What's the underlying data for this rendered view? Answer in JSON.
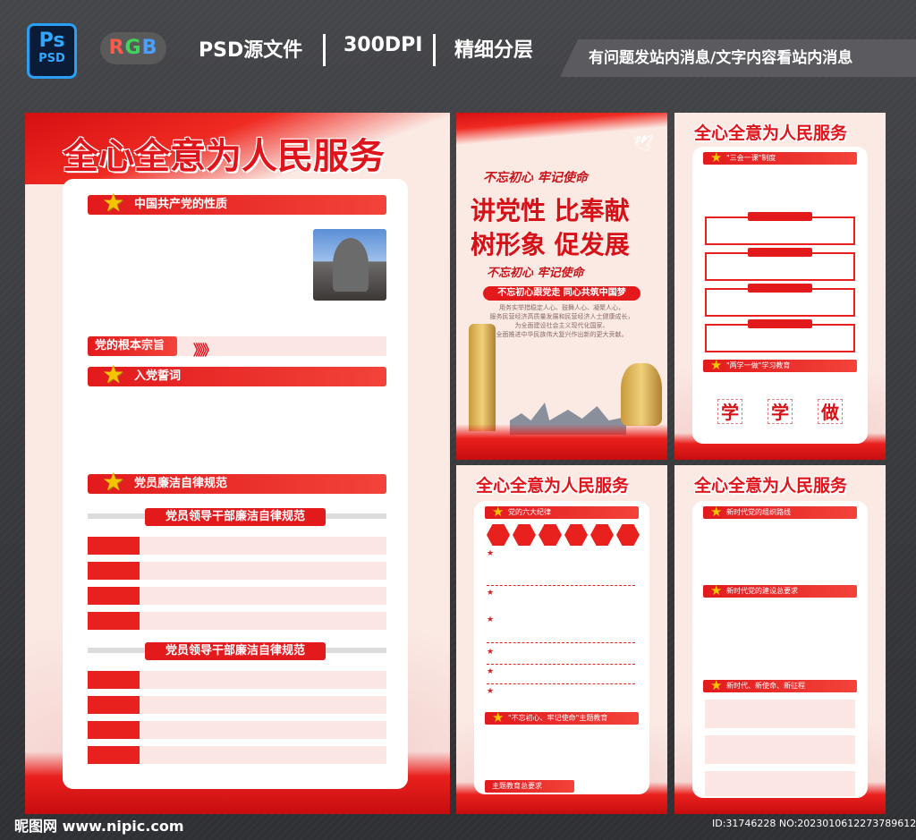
{
  "header": {
    "ps_big": "Ps",
    "ps_small": "PSD",
    "rgb": [
      "R",
      "G",
      "B"
    ],
    "psd_label": "PSD源文件",
    "dpi_label": "300DPI",
    "layer_label": "精细分层",
    "notice": "有问题发站内消息/文字内容看站内消息"
  },
  "panel_main": {
    "title": "全心全意为人民服务",
    "section1": "中国共产党的性质",
    "section2": "党的根本宗旨",
    "section2_chevrons": "》》》",
    "section3": "入党誓词",
    "section4": "党员廉洁自律规范",
    "sub1": "党员领导干部廉洁自律规范",
    "sub2": "党员领导干部廉洁自律规范"
  },
  "panel_poster": {
    "line1": "不忘初心 牢记使命",
    "line2": "讲党性 比奉献",
    "line3": "树形象 促发展",
    "line4": "不忘初心 牢记使命",
    "pill": "不忘初心跟党走 同心共筑中国梦",
    "para": [
      "用务实举措稳定人心、鼓舞人心、凝聚人心，",
      "服务民营经济高质量发展和民营经济人士健康成长，",
      "为全面建设社会主义现代化国家、",
      "全面推进中华民族伟大复兴作出新的更大贡献。"
    ]
  },
  "panel_topright": {
    "title": "全心全意为人民服务",
    "section1": "\"三会一课\"制度",
    "section2": "\"两学一做\"学习教育",
    "calli": [
      "学",
      "学",
      "做"
    ]
  },
  "panel_midbottom": {
    "title": "全心全意为人民服务",
    "section1": "党的六大纪律",
    "section2": "\"不忘初心、牢记使命\"主题教育",
    "footer": "主题教育总要求"
  },
  "panel_rightbottom": {
    "title": "全心全意为人民服务",
    "section1": "新时代党的组织路线",
    "section2": "新时代党的建设总要求",
    "section3": "新时代、新使命、新征程"
  },
  "footer": {
    "site": "昵图网 www.nipic.com",
    "id": "ID:31746228 NO:20230106122737896127"
  },
  "colors": {
    "accent": "#e21a1c",
    "gold": "#f6c400",
    "bg": "#3a3b3f"
  }
}
